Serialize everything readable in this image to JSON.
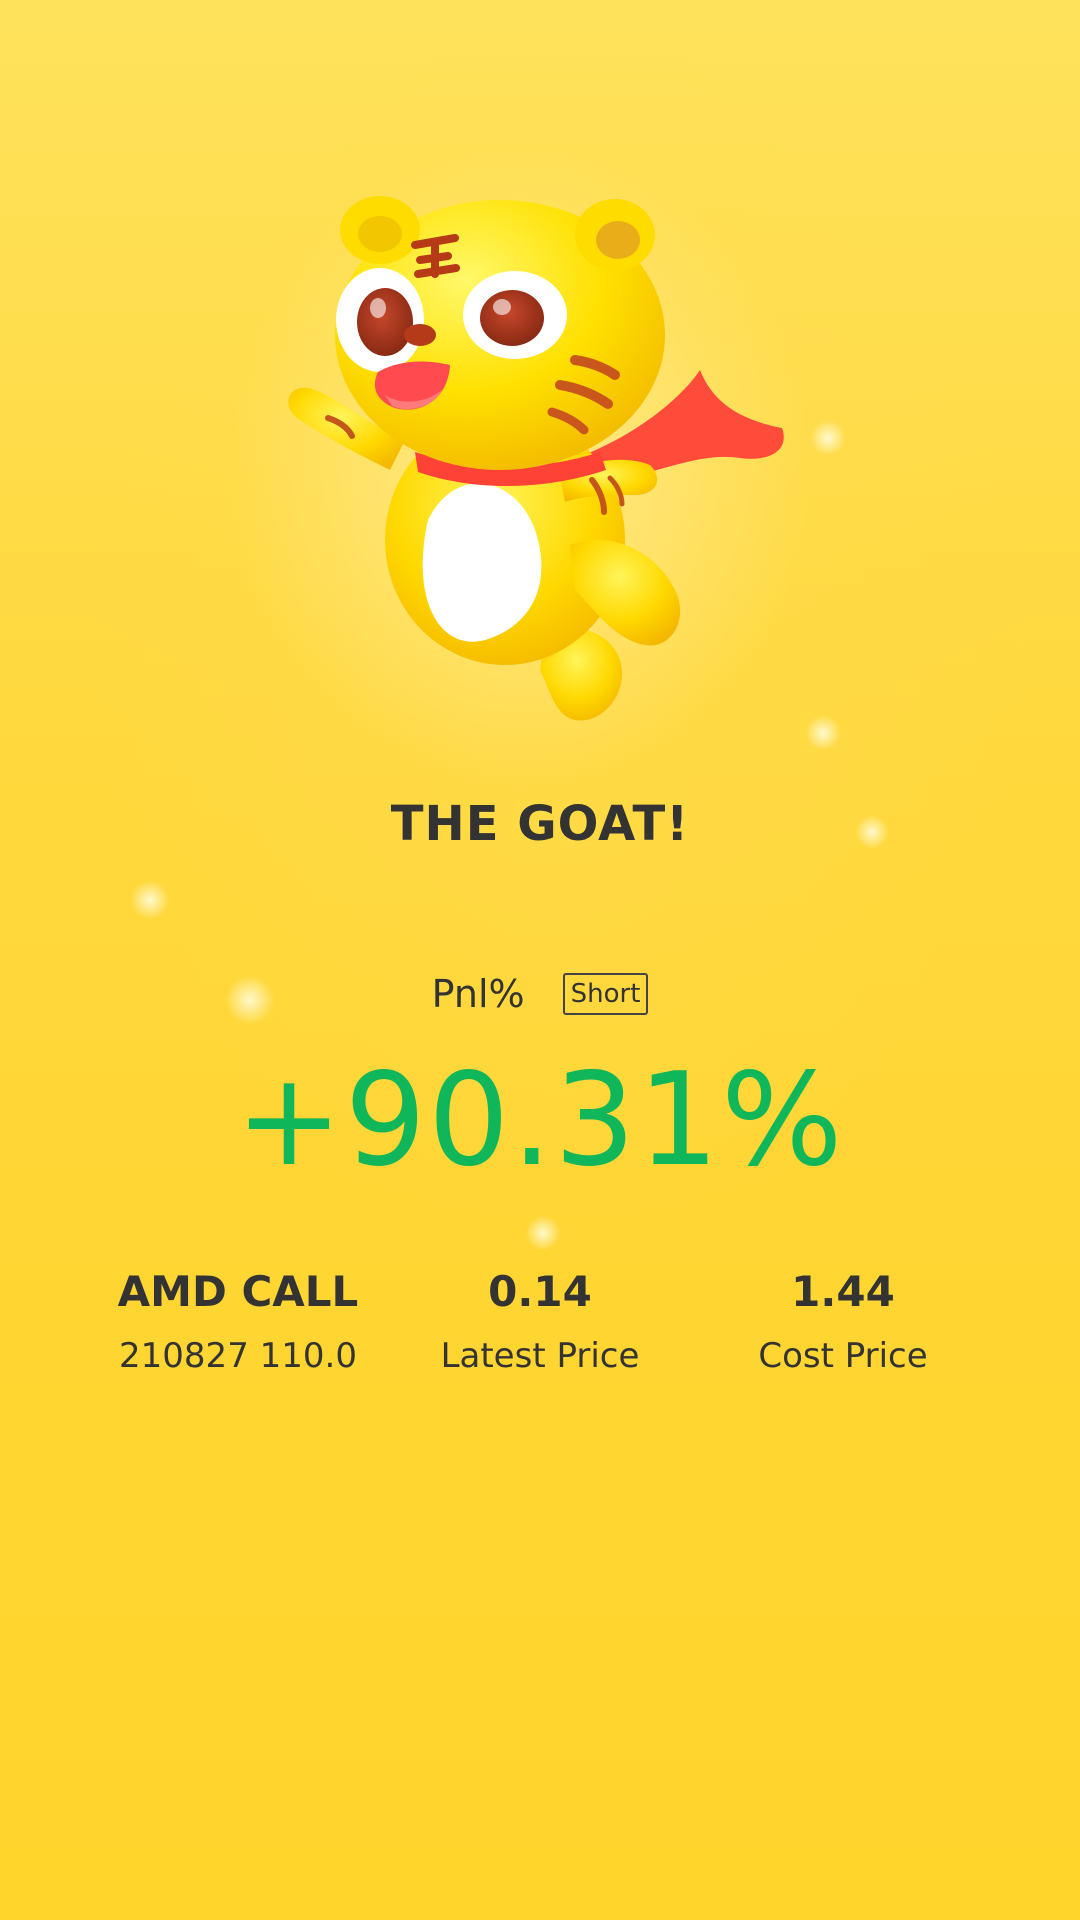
{
  "header": {
    "title": "THE GOAT!"
  },
  "pnl": {
    "label": "Pnl%",
    "direction_badge": "Short",
    "value": "+90.31%",
    "value_color": "#10b65a"
  },
  "stats": {
    "instrument": {
      "name": "AMD CALL",
      "detail": "210827 110.0"
    },
    "latest": {
      "value": "0.14",
      "label": "Latest Price"
    },
    "cost": {
      "value": "1.44",
      "label": "Cost Price"
    }
  },
  "mascot": {
    "icon": "tiger-mascot-icon"
  }
}
